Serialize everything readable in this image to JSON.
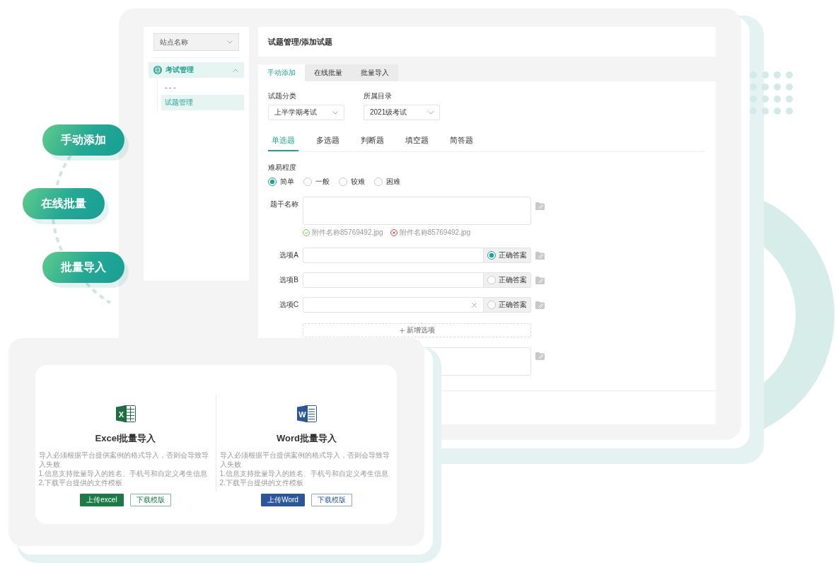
{
  "steps": [
    {
      "label": "手动添加"
    },
    {
      "label": "在线批量"
    },
    {
      "label": "批量导入"
    }
  ],
  "sidebar": {
    "site_select": {
      "value": "站点名称"
    },
    "items": [
      {
        "label": "考试管理",
        "expanded": true,
        "children": [
          {
            "label": "- - -",
            "selected": false
          },
          {
            "label": "试题管理",
            "selected": true
          }
        ]
      }
    ]
  },
  "header": {
    "breadcrumb": "试题管理/添加试题"
  },
  "tabs": [
    {
      "label": "手动添加",
      "selected": true
    },
    {
      "label": "在线批量",
      "selected": false
    },
    {
      "label": "批量导入",
      "selected": false
    }
  ],
  "filters": [
    {
      "label": "试题分类",
      "value": "上半学期考试"
    },
    {
      "label": "所属目录",
      "value": "2021级考试"
    }
  ],
  "question_types": [
    {
      "label": "单选题",
      "selected": true
    },
    {
      "label": "多选题",
      "selected": false
    },
    {
      "label": "判断题",
      "selected": false
    },
    {
      "label": "填空题",
      "selected": false
    },
    {
      "label": "简答题",
      "selected": false
    }
  ],
  "difficulty": {
    "label": "难易程度",
    "options": [
      {
        "label": "简单",
        "selected": true
      },
      {
        "label": "一般",
        "selected": false
      },
      {
        "label": "较难",
        "selected": false
      },
      {
        "label": "困难",
        "selected": false
      }
    ]
  },
  "stem": {
    "label": "题干名称",
    "attachments": [
      {
        "name": "附件名称85769492.jpg",
        "failed": false
      },
      {
        "name": "附件名称85769492.jpg",
        "failed": true
      }
    ]
  },
  "options": [
    {
      "label": "选项A",
      "answer_label": "正确答案",
      "correct": true,
      "clearable": false
    },
    {
      "label": "选项B",
      "answer_label": "正确答案",
      "correct": false,
      "clearable": false
    },
    {
      "label": "选项C",
      "answer_label": "正确答案",
      "correct": false,
      "clearable": true
    }
  ],
  "add_option": {
    "label": "新增选项"
  },
  "import_cards": [
    {
      "kind": "excel",
      "icon_letter": "X",
      "title": "Excel批量导入",
      "lines": [
        "导入必须根据平台提供案例的格式导入，否则会导致导入失败",
        "1.信息支持批量导入的姓名、手机号和自定义考生信息",
        "2.下载平台提供的文件模板"
      ],
      "upload": "上传excel",
      "download": "下载模版"
    },
    {
      "kind": "word",
      "icon_letter": "W",
      "title": "Word批量导入",
      "lines": [
        "导入必须根据平台提供案例的格式导入，否则会导致导入失败",
        "1.信息支持批量导入的姓名、手机号和自定义考生信息",
        "2.下载平台提供的文件模板"
      ],
      "upload": "上传Word",
      "download": "下载模版"
    }
  ]
}
